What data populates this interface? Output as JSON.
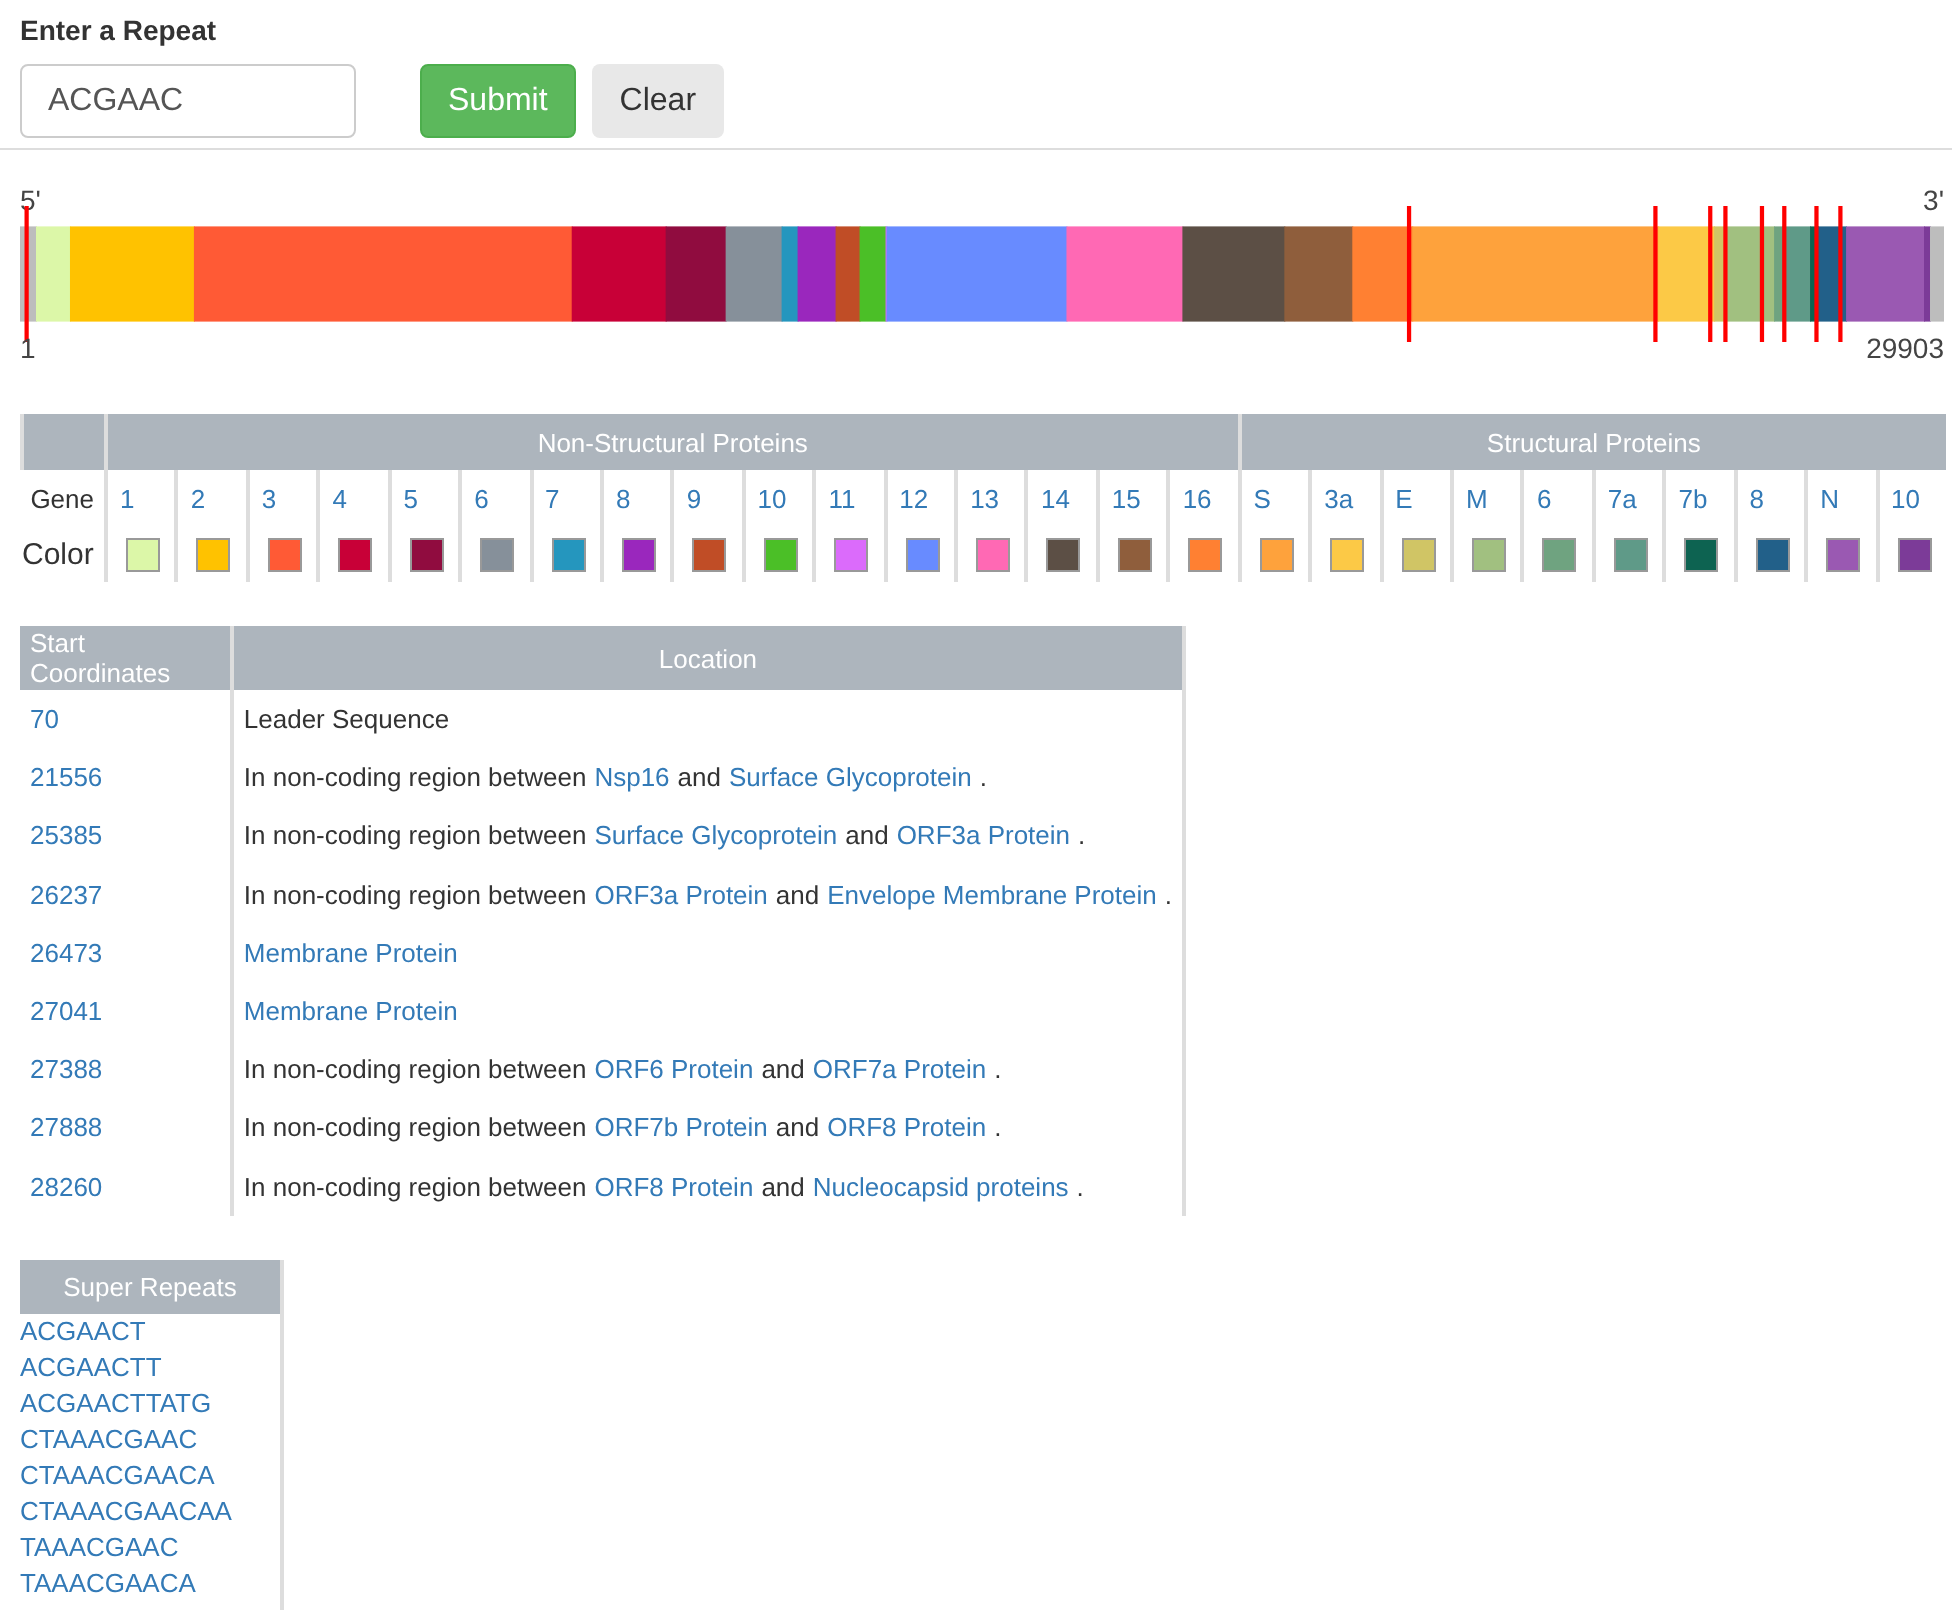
{
  "repeat_form": {
    "label": "Enter a Repeat",
    "value": "ACGAAC",
    "buttons": [
      {
        "label": "Submit",
        "kind": "primary"
      },
      {
        "label": "Clear",
        "kind": "secondary"
      }
    ]
  },
  "genome_map": {
    "left_end": "5'",
    "right_end": "3'",
    "start": "1",
    "end": "29903"
  },
  "gene_table": {
    "row_labels": [
      "Gene",
      "Color"
    ],
    "groups": [
      {
        "title": "Non-Structural Proteins",
        "genes": [
          {
            "label": "1",
            "color": "#dcf7a8"
          },
          {
            "label": "2",
            "color": "#ffc200"
          },
          {
            "label": "3",
            "color": "#ff5a35"
          },
          {
            "label": "4",
            "color": "#c80037"
          },
          {
            "label": "5",
            "color": "#900c3f"
          },
          {
            "label": "6",
            "color": "#86909a"
          },
          {
            "label": "7",
            "color": "#2596be"
          },
          {
            "label": "8",
            "color": "#9a27bd"
          },
          {
            "label": "9",
            "color": "#c04d26"
          },
          {
            "label": "10",
            "color": "#4bbf27"
          },
          {
            "label": "11",
            "color": "#db6bfb"
          },
          {
            "label": "12",
            "color": "#688bff"
          },
          {
            "label": "13",
            "color": "#ff69b4"
          },
          {
            "label": "14",
            "color": "#5c4f45"
          },
          {
            "label": "15",
            "color": "#8f5e3c"
          },
          {
            "label": "16",
            "color": "#ff8032"
          }
        ]
      },
      {
        "title": "Structural Proteins",
        "genes": [
          {
            "label": "S",
            "color": "#fea23c"
          },
          {
            "label": "3a",
            "color": "#fcc946"
          },
          {
            "label": "E",
            "color": "#d0c565"
          },
          {
            "label": "M",
            "color": "#a1c080"
          },
          {
            "label": "6",
            "color": "#6fa380"
          },
          {
            "label": "7a",
            "color": "#5f9a88"
          },
          {
            "label": "7b",
            "color": "#0d6351"
          },
          {
            "label": "8",
            "color": "#226089"
          },
          {
            "label": "N",
            "color": "#9a59b2"
          },
          {
            "label": "10",
            "color": "#7c3b98"
          }
        ]
      }
    ]
  },
  "repeats_table": {
    "columns": [
      "Start Coordinates",
      "Location"
    ],
    "rows": [
      {
        "start": "70",
        "location": [
          {
            "text": "Leader Sequence",
            "link": false
          }
        ]
      },
      {
        "start": "21556",
        "location": [
          {
            "text": "In non-coding region between",
            "link": false
          },
          {
            "text": "Nsp16",
            "link": true
          },
          {
            "text": "and",
            "link": false
          },
          {
            "text": "Surface Glycoprotein",
            "link": true
          },
          {
            "text": ".",
            "link": false
          }
        ]
      },
      {
        "start": "25385",
        "location": [
          {
            "text": "In non-coding region between",
            "link": false
          },
          {
            "text": "Surface Glycoprotein",
            "link": true
          },
          {
            "text": "and",
            "link": false
          },
          {
            "text": "ORF3a Protein",
            "link": true
          },
          {
            "text": ".",
            "link": false
          }
        ]
      },
      {
        "start": "26237",
        "location": [
          {
            "text": "In non-coding region between",
            "link": false
          },
          {
            "text": "ORF3a Protein",
            "link": true
          },
          {
            "text": "and",
            "link": false
          },
          {
            "text": "Envelope Membrane Protein",
            "link": true
          },
          {
            "text": ".",
            "link": false
          }
        ]
      },
      {
        "start": "26473",
        "location": [
          {
            "text": "Membrane Protein",
            "link": true
          }
        ]
      },
      {
        "start": "27041",
        "location": [
          {
            "text": "Membrane Protein",
            "link": true
          }
        ]
      },
      {
        "start": "27388",
        "location": [
          {
            "text": "In non-coding region between",
            "link": false
          },
          {
            "text": "ORF6 Protein",
            "link": true
          },
          {
            "text": "and",
            "link": false
          },
          {
            "text": "ORF7a Protein",
            "link": true
          },
          {
            "text": ".",
            "link": false
          }
        ]
      },
      {
        "start": "27888",
        "location": [
          {
            "text": "In non-coding region between",
            "link": false
          },
          {
            "text": "ORF7b Protein",
            "link": true
          },
          {
            "text": "and",
            "link": false
          },
          {
            "text": "ORF8 Protein",
            "link": true
          },
          {
            "text": ".",
            "link": false
          }
        ]
      },
      {
        "start": "28260",
        "location": [
          {
            "text": "In non-coding region between",
            "link": false
          },
          {
            "text": "ORF8 Protein",
            "link": true
          },
          {
            "text": "and",
            "link": false
          },
          {
            "text": "Nucleocapsid proteins",
            "link": true
          },
          {
            "text": ".",
            "link": false
          }
        ]
      }
    ]
  },
  "super_repeats": {
    "title": "Super Repeats",
    "items": [
      "ACGAACT",
      "ACGAACTT",
      "ACGAACTTATG",
      "CTAAACGAAC",
      "CTAAACGAACA",
      "CTAAACGAACAA",
      "TAAACGAAC",
      "TAAACGAACA"
    ]
  }
}
